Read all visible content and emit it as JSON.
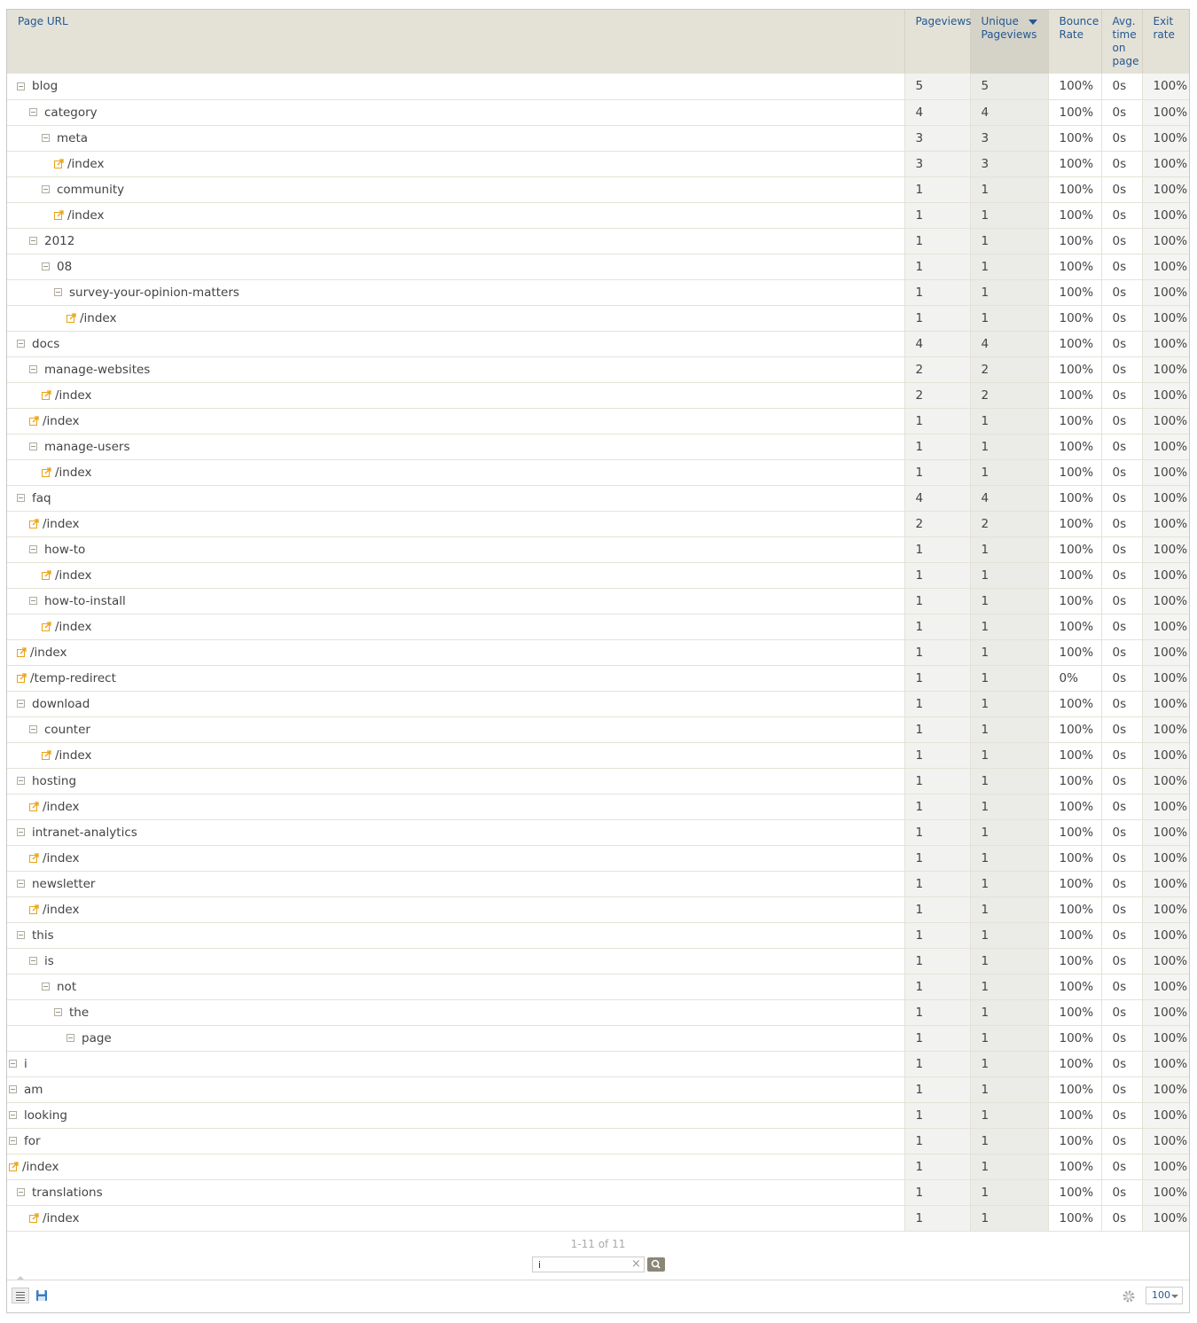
{
  "columns": {
    "label": "Page URL",
    "pageviews": "Pageviews",
    "unique_pageviews": "Unique Pageviews",
    "bounce_rate": "Bounce Rate",
    "avg_time": "Avg. time on page",
    "exit_rate": "Exit rate"
  },
  "sorted_column": "unique_pageviews",
  "sort_direction": "descending",
  "rows": [
    {
      "level": 0,
      "type": "folder",
      "label": "blog",
      "pv": "5",
      "upv": "5",
      "br": "100%",
      "avg": "0s",
      "exit": "100%"
    },
    {
      "level": 1,
      "type": "folder",
      "label": "category",
      "pv": "4",
      "upv": "4",
      "br": "100%",
      "avg": "0s",
      "exit": "100%"
    },
    {
      "level": 2,
      "type": "folder",
      "label": "meta",
      "pv": "3",
      "upv": "3",
      "br": "100%",
      "avg": "0s",
      "exit": "100%"
    },
    {
      "level": 3,
      "type": "page",
      "label": "/index",
      "pv": "3",
      "upv": "3",
      "br": "100%",
      "avg": "0s",
      "exit": "100%"
    },
    {
      "level": 2,
      "type": "folder",
      "label": "community",
      "pv": "1",
      "upv": "1",
      "br": "100%",
      "avg": "0s",
      "exit": "100%"
    },
    {
      "level": 3,
      "type": "page",
      "label": "/index",
      "pv": "1",
      "upv": "1",
      "br": "100%",
      "avg": "0s",
      "exit": "100%"
    },
    {
      "level": 1,
      "type": "folder",
      "label": "2012",
      "pv": "1",
      "upv": "1",
      "br": "100%",
      "avg": "0s",
      "exit": "100%"
    },
    {
      "level": 2,
      "type": "folder",
      "label": "08",
      "pv": "1",
      "upv": "1",
      "br": "100%",
      "avg": "0s",
      "exit": "100%"
    },
    {
      "level": 3,
      "type": "folder",
      "label": "survey-your-opinion-matters",
      "pv": "1",
      "upv": "1",
      "br": "100%",
      "avg": "0s",
      "exit": "100%"
    },
    {
      "level": 4,
      "type": "page",
      "label": "/index",
      "pv": "1",
      "upv": "1",
      "br": "100%",
      "avg": "0s",
      "exit": "100%"
    },
    {
      "level": 0,
      "type": "folder",
      "label": "docs",
      "pv": "4",
      "upv": "4",
      "br": "100%",
      "avg": "0s",
      "exit": "100%"
    },
    {
      "level": 1,
      "type": "folder",
      "label": "manage-websites",
      "pv": "2",
      "upv": "2",
      "br": "100%",
      "avg": "0s",
      "exit": "100%"
    },
    {
      "level": 2,
      "type": "page",
      "label": "/index",
      "pv": "2",
      "upv": "2",
      "br": "100%",
      "avg": "0s",
      "exit": "100%"
    },
    {
      "level": 1,
      "type": "page",
      "label": "/index",
      "pv": "1",
      "upv": "1",
      "br": "100%",
      "avg": "0s",
      "exit": "100%"
    },
    {
      "level": 1,
      "type": "folder",
      "label": "manage-users",
      "pv": "1",
      "upv": "1",
      "br": "100%",
      "avg": "0s",
      "exit": "100%"
    },
    {
      "level": 2,
      "type": "page",
      "label": "/index",
      "pv": "1",
      "upv": "1",
      "br": "100%",
      "avg": "0s",
      "exit": "100%"
    },
    {
      "level": 0,
      "type": "folder",
      "label": "faq",
      "pv": "4",
      "upv": "4",
      "br": "100%",
      "avg": "0s",
      "exit": "100%"
    },
    {
      "level": 1,
      "type": "page",
      "label": "/index",
      "pv": "2",
      "upv": "2",
      "br": "100%",
      "avg": "0s",
      "exit": "100%"
    },
    {
      "level": 1,
      "type": "folder",
      "label": "how-to",
      "pv": "1",
      "upv": "1",
      "br": "100%",
      "avg": "0s",
      "exit": "100%"
    },
    {
      "level": 2,
      "type": "page",
      "label": "/index",
      "pv": "1",
      "upv": "1",
      "br": "100%",
      "avg": "0s",
      "exit": "100%"
    },
    {
      "level": 1,
      "type": "folder",
      "label": "how-to-install",
      "pv": "1",
      "upv": "1",
      "br": "100%",
      "avg": "0s",
      "exit": "100%"
    },
    {
      "level": 2,
      "type": "page",
      "label": "/index",
      "pv": "1",
      "upv": "1",
      "br": "100%",
      "avg": "0s",
      "exit": "100%"
    },
    {
      "level": 0,
      "type": "page",
      "label": "/index",
      "pv": "1",
      "upv": "1",
      "br": "100%",
      "avg": "0s",
      "exit": "100%"
    },
    {
      "level": 0,
      "type": "page",
      "label": "/temp-redirect",
      "pv": "1",
      "upv": "1",
      "br": "0%",
      "avg": "0s",
      "exit": "100%"
    },
    {
      "level": 0,
      "type": "folder",
      "label": "download",
      "pv": "1",
      "upv": "1",
      "br": "100%",
      "avg": "0s",
      "exit": "100%"
    },
    {
      "level": 1,
      "type": "folder",
      "label": "counter",
      "pv": "1",
      "upv": "1",
      "br": "100%",
      "avg": "0s",
      "exit": "100%"
    },
    {
      "level": 2,
      "type": "page",
      "label": "/index",
      "pv": "1",
      "upv": "1",
      "br": "100%",
      "avg": "0s",
      "exit": "100%"
    },
    {
      "level": 0,
      "type": "folder",
      "label": "hosting",
      "pv": "1",
      "upv": "1",
      "br": "100%",
      "avg": "0s",
      "exit": "100%"
    },
    {
      "level": 1,
      "type": "page",
      "label": "/index",
      "pv": "1",
      "upv": "1",
      "br": "100%",
      "avg": "0s",
      "exit": "100%"
    },
    {
      "level": 0,
      "type": "folder",
      "label": "intranet-analytics",
      "pv": "1",
      "upv": "1",
      "br": "100%",
      "avg": "0s",
      "exit": "100%"
    },
    {
      "level": 1,
      "type": "page",
      "label": "/index",
      "pv": "1",
      "upv": "1",
      "br": "100%",
      "avg": "0s",
      "exit": "100%"
    },
    {
      "level": 0,
      "type": "folder",
      "label": "newsletter",
      "pv": "1",
      "upv": "1",
      "br": "100%",
      "avg": "0s",
      "exit": "100%"
    },
    {
      "level": 1,
      "type": "page",
      "label": "/index",
      "pv": "1",
      "upv": "1",
      "br": "100%",
      "avg": "0s",
      "exit": "100%"
    },
    {
      "level": 0,
      "type": "folder",
      "label": "this",
      "pv": "1",
      "upv": "1",
      "br": "100%",
      "avg": "0s",
      "exit": "100%"
    },
    {
      "level": 1,
      "type": "folder",
      "label": "is",
      "pv": "1",
      "upv": "1",
      "br": "100%",
      "avg": "0s",
      "exit": "100%"
    },
    {
      "level": 2,
      "type": "folder",
      "label": "not",
      "pv": "1",
      "upv": "1",
      "br": "100%",
      "avg": "0s",
      "exit": "100%"
    },
    {
      "level": 3,
      "type": "folder",
      "label": "the",
      "pv": "1",
      "upv": "1",
      "br": "100%",
      "avg": "0s",
      "exit": "100%"
    },
    {
      "level": 4,
      "type": "folder",
      "label": "page",
      "pv": "1",
      "upv": "1",
      "br": "100%",
      "avg": "0s",
      "exit": "100%"
    },
    {
      "level": -1,
      "type": "folder",
      "label": "i",
      "pv": "1",
      "upv": "1",
      "br": "100%",
      "avg": "0s",
      "exit": "100%"
    },
    {
      "level": -1,
      "type": "folder",
      "label": "am",
      "pv": "1",
      "upv": "1",
      "br": "100%",
      "avg": "0s",
      "exit": "100%"
    },
    {
      "level": -1,
      "type": "folder",
      "label": "looking",
      "pv": "1",
      "upv": "1",
      "br": "100%",
      "avg": "0s",
      "exit": "100%"
    },
    {
      "level": -1,
      "type": "folder",
      "label": "for",
      "pv": "1",
      "upv": "1",
      "br": "100%",
      "avg": "0s",
      "exit": "100%"
    },
    {
      "level": -1,
      "type": "page",
      "label": "/index",
      "pv": "1",
      "upv": "1",
      "br": "100%",
      "avg": "0s",
      "exit": "100%"
    },
    {
      "level": 0,
      "type": "folder",
      "label": "translations",
      "pv": "1",
      "upv": "1",
      "br": "100%",
      "avg": "0s",
      "exit": "100%"
    },
    {
      "level": 1,
      "type": "page",
      "label": "/index",
      "pv": "1",
      "upv": "1",
      "br": "100%",
      "avg": "0s",
      "exit": "100%"
    }
  ],
  "pagination": "1-11 of 11",
  "search": {
    "value": "i"
  },
  "limit": "100",
  "icons": {
    "collapse": "collapse-icon",
    "link": "external-link-icon",
    "table_view": "table-view-icon",
    "export": "save-icon",
    "settings": "gear-icon"
  },
  "colors": {
    "header_bg": "#e4e2d7",
    "header_text": "#255792",
    "link_icon": "#e8a317"
  }
}
